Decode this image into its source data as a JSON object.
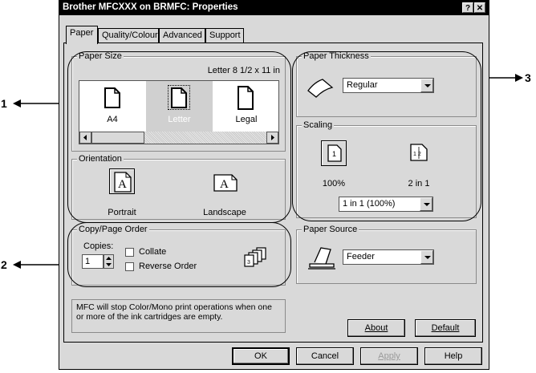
{
  "window": {
    "title": "Brother MFCXXX on BRMFC: Properties",
    "help_btn": "?",
    "close_btn": "✕"
  },
  "tabs": [
    "Paper",
    "Quality/Colour",
    "Advanced",
    "Support"
  ],
  "paper_size": {
    "legend": "Paper Size",
    "current": "Letter 8 1/2 x 11 in",
    "items": [
      "A4",
      "Letter",
      "Legal"
    ],
    "selected": "Letter"
  },
  "orientation": {
    "legend": "Orientation",
    "portrait": "Portrait",
    "landscape": "Landscape",
    "selected": "Portrait"
  },
  "copy_order": {
    "legend": "Copy/Page Order",
    "copies_label": "Copies:",
    "copies_value": "1",
    "collate": "Collate",
    "reverse": "Reverse Order"
  },
  "paper_thickness": {
    "legend": "Paper Thickness",
    "value": "Regular"
  },
  "scaling": {
    "legend": "Scaling",
    "opt1": "100%",
    "opt2": "2 in 1",
    "value": "1 in 1 (100%)",
    "icon1_digit": "1",
    "icon2_digits": "1 2"
  },
  "paper_source": {
    "legend": "Paper Source",
    "value": "Feeder"
  },
  "status_message": "MFC will stop Color/Mono print operations when one or more of the ink cartridges are empty.",
  "buttons": {
    "about": "About",
    "default": "Default",
    "ok": "OK",
    "cancel": "Cancel",
    "apply": "Apply",
    "help": "Help"
  },
  "callouts": {
    "one": "1",
    "two": "2",
    "three": "3"
  }
}
